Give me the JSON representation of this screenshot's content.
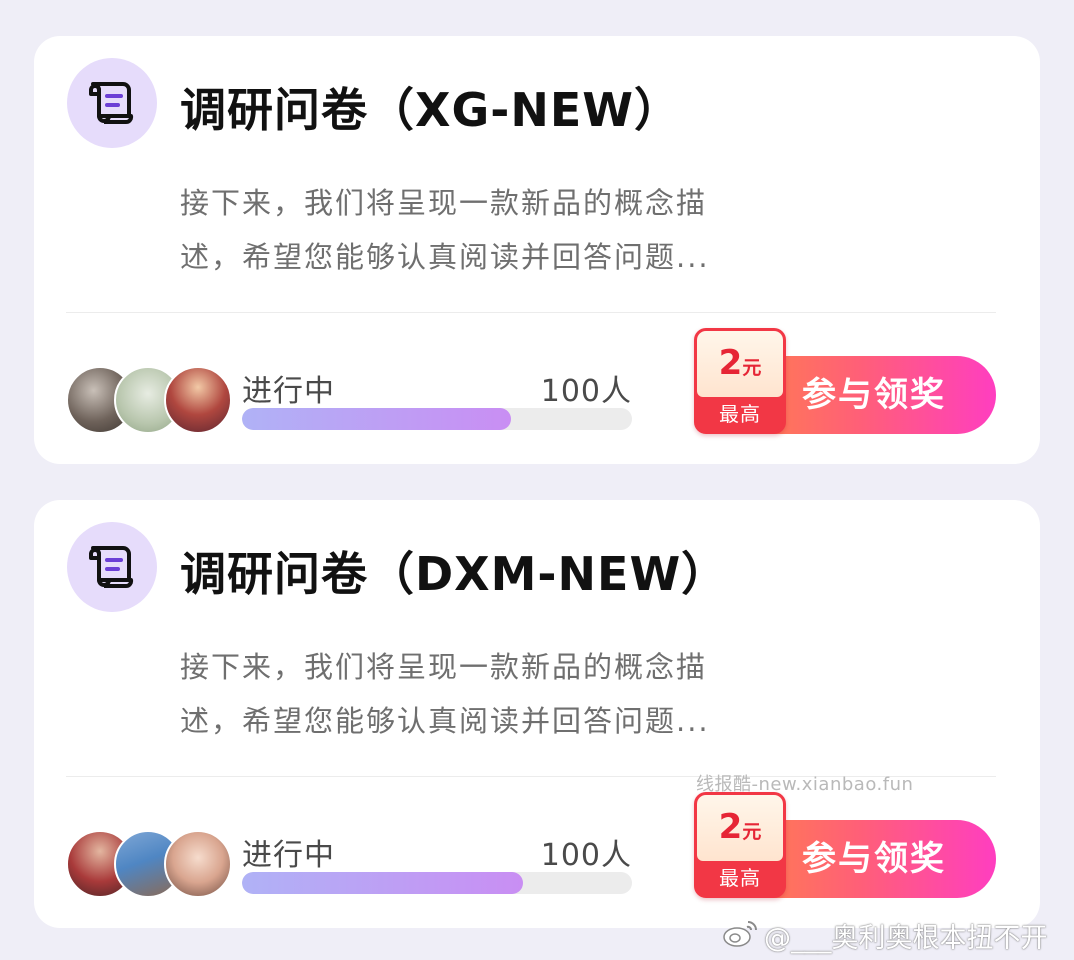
{
  "cards": [
    {
      "icon": "scroll-list-icon",
      "title": "调研问卷（XG-NEW）",
      "description": "接下来，我们将呈现一款新品的概念描述，希望您能够认真阅读并回答问题...",
      "status": "进行中",
      "participants": "100人",
      "progress_fraction": 0.69,
      "reward": {
        "amount": "2",
        "unit": "元",
        "tag": "最高",
        "button_label": "参与领奖"
      }
    },
    {
      "icon": "scroll-list-icon",
      "title": "调研问卷（DXM-NEW）",
      "description": "接下来，我们将呈现一款新品的概念描述，希望您能够认真阅读并回答问题...",
      "status": "进行中",
      "participants": "100人",
      "progress_fraction": 0.72,
      "reward": {
        "amount": "2",
        "unit": "元",
        "tag": "最高",
        "button_label": "参与领奖"
      }
    }
  ],
  "watermarks": {
    "site": "线报酷-new.xianbao.fun",
    "user": "@___奥利奥根本扭不开"
  },
  "colors": {
    "background": "#efeef7",
    "icon_circle": "#e6dcfb",
    "icon_accent": "#6c3fd6",
    "progress_start": "#b0b2f6",
    "progress_end": "#c98ef3",
    "button_start": "#ff8b3d",
    "button_end": "#ff3ec0",
    "badge_red": "#f23745"
  }
}
